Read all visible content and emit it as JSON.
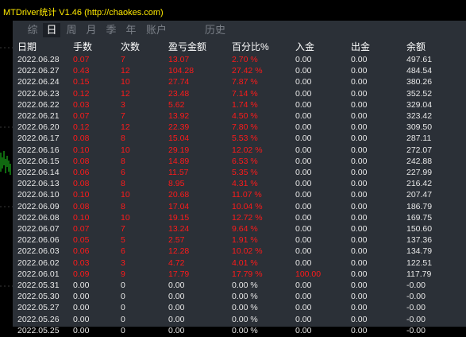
{
  "app": {
    "title": "MTDriver统计 V1.46 (http://chaokes.com)"
  },
  "tabs": [
    {
      "label": "综",
      "active": false
    },
    {
      "label": "日",
      "active": true
    },
    {
      "label": "周",
      "active": false
    },
    {
      "label": "月",
      "active": false
    },
    {
      "label": "季",
      "active": false
    },
    {
      "label": "年",
      "active": false
    },
    {
      "label": "账户",
      "active": false
    },
    {
      "label": "历史",
      "active": false
    }
  ],
  "columns": [
    "日期",
    "手数",
    "次数",
    "盈亏金额",
    "百分比%",
    "入金",
    "出金",
    "余额"
  ],
  "rows": [
    {
      "date": "2022.06.28",
      "lots": "0.07",
      "count": "7",
      "pnl": "13.07",
      "pct": "2.70 %",
      "deposit": "0.00",
      "withdraw": "0.00",
      "balance": "497.61",
      "color": "red"
    },
    {
      "date": "2022.06.27",
      "lots": "0.43",
      "count": "12",
      "pnl": "104.28",
      "pct": "27.42 %",
      "deposit": "0.00",
      "withdraw": "0.00",
      "balance": "484.54",
      "color": "red"
    },
    {
      "date": "2022.06.24",
      "lots": "0.15",
      "count": "10",
      "pnl": "27.74",
      "pct": "7.87 %",
      "deposit": "0.00",
      "withdraw": "0.00",
      "balance": "380.26",
      "color": "red"
    },
    {
      "date": "2022.06.23",
      "lots": "0.12",
      "count": "12",
      "pnl": "23.48",
      "pct": "7.14 %",
      "deposit": "0.00",
      "withdraw": "0.00",
      "balance": "352.52",
      "color": "red"
    },
    {
      "date": "2022.06.22",
      "lots": "0.03",
      "count": "3",
      "pnl": "5.62",
      "pct": "1.74 %",
      "deposit": "0.00",
      "withdraw": "0.00",
      "balance": "329.04",
      "color": "red"
    },
    {
      "date": "2022.06.21",
      "lots": "0.07",
      "count": "7",
      "pnl": "13.92",
      "pct": "4.50 %",
      "deposit": "0.00",
      "withdraw": "0.00",
      "balance": "323.42",
      "color": "red"
    },
    {
      "date": "2022.06.20",
      "lots": "0.12",
      "count": "12",
      "pnl": "22.39",
      "pct": "7.80 %",
      "deposit": "0.00",
      "withdraw": "0.00",
      "balance": "309.50",
      "color": "red"
    },
    {
      "date": "2022.06.17",
      "lots": "0.08",
      "count": "8",
      "pnl": "15.04",
      "pct": "5.53 %",
      "deposit": "0.00",
      "withdraw": "0.00",
      "balance": "287.11",
      "color": "red"
    },
    {
      "date": "2022.06.16",
      "lots": "0.10",
      "count": "10",
      "pnl": "29.19",
      "pct": "12.02 %",
      "deposit": "0.00",
      "withdraw": "0.00",
      "balance": "272.07",
      "color": "red"
    },
    {
      "date": "2022.06.15",
      "lots": "0.08",
      "count": "8",
      "pnl": "14.89",
      "pct": "6.53 %",
      "deposit": "0.00",
      "withdraw": "0.00",
      "balance": "242.88",
      "color": "red"
    },
    {
      "date": "2022.06.14",
      "lots": "0.06",
      "count": "6",
      "pnl": "11.57",
      "pct": "5.35 %",
      "deposit": "0.00",
      "withdraw": "0.00",
      "balance": "227.99",
      "color": "red"
    },
    {
      "date": "2022.06.13",
      "lots": "0.08",
      "count": "8",
      "pnl": "8.95",
      "pct": "4.31 %",
      "deposit": "0.00",
      "withdraw": "0.00",
      "balance": "216.42",
      "color": "red"
    },
    {
      "date": "2022.06.10",
      "lots": "0.10",
      "count": "10",
      "pnl": "20.68",
      "pct": "11.07 %",
      "deposit": "0.00",
      "withdraw": "0.00",
      "balance": "207.47",
      "color": "red"
    },
    {
      "date": "2022.06.09",
      "lots": "0.08",
      "count": "8",
      "pnl": "17.04",
      "pct": "10.04 %",
      "deposit": "0.00",
      "withdraw": "0.00",
      "balance": "186.79",
      "color": "red"
    },
    {
      "date": "2022.06.08",
      "lots": "0.10",
      "count": "10",
      "pnl": "19.15",
      "pct": "12.72 %",
      "deposit": "0.00",
      "withdraw": "0.00",
      "balance": "169.75",
      "color": "red"
    },
    {
      "date": "2022.06.07",
      "lots": "0.07",
      "count": "7",
      "pnl": "13.24",
      "pct": "9.64 %",
      "deposit": "0.00",
      "withdraw": "0.00",
      "balance": "150.60",
      "color": "red"
    },
    {
      "date": "2022.06.06",
      "lots": "0.05",
      "count": "5",
      "pnl": "2.57",
      "pct": "1.91 %",
      "deposit": "0.00",
      "withdraw": "0.00",
      "balance": "137.36",
      "color": "red"
    },
    {
      "date": "2022.06.03",
      "lots": "0.06",
      "count": "6",
      "pnl": "12.28",
      "pct": "10.02 %",
      "deposit": "0.00",
      "withdraw": "0.00",
      "balance": "134.79",
      "color": "red"
    },
    {
      "date": "2022.06.02",
      "lots": "0.03",
      "count": "3",
      "pnl": "4.72",
      "pct": "4.01 %",
      "deposit": "0.00",
      "withdraw": "0.00",
      "balance": "122.51",
      "color": "red"
    },
    {
      "date": "2022.06.01",
      "lots": "0.09",
      "count": "9",
      "pnl": "17.79",
      "pct": "17.79 %",
      "deposit": "100.00",
      "withdraw": "0.00",
      "balance": "117.79",
      "color": "red",
      "deposit_hot": true
    },
    {
      "date": "2022.05.31",
      "lots": "0.00",
      "count": "0",
      "pnl": "0.00",
      "pct": "0.00 %",
      "deposit": "0.00",
      "withdraw": "0.00",
      "balance": "-0.00",
      "color": "white"
    },
    {
      "date": "2022.05.30",
      "lots": "0.00",
      "count": "0",
      "pnl": "0.00",
      "pct": "0.00 %",
      "deposit": "0.00",
      "withdraw": "0.00",
      "balance": "-0.00",
      "color": "white"
    },
    {
      "date": "2022.05.27",
      "lots": "0.00",
      "count": "0",
      "pnl": "0.00",
      "pct": "0.00 %",
      "deposit": "0.00",
      "withdraw": "0.00",
      "balance": "-0.00",
      "color": "white"
    },
    {
      "date": "2022.05.26",
      "lots": "0.00",
      "count": "0",
      "pnl": "0.00",
      "pct": "0.00 %",
      "deposit": "0.00",
      "withdraw": "0.00",
      "balance": "-0.00",
      "color": "white"
    },
    {
      "date": "2022.05.25",
      "lots": "0.00",
      "count": "0",
      "pnl": "0.00",
      "pct": "0.00 %",
      "deposit": "0.00",
      "withdraw": "0.00",
      "balance": "-0.00",
      "color": "white"
    }
  ],
  "colors": {
    "panel": "#2b3037",
    "positive": "#ff1a1a",
    "neutral": "#e8e8e8",
    "title": "#ffea00",
    "signal": "#20d020"
  }
}
